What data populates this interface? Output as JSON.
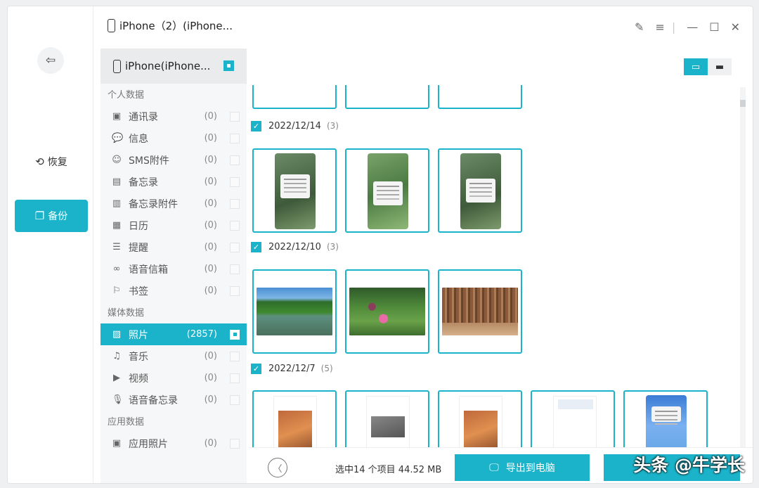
{
  "window": {
    "title": "iPhone（2）(iPhone..."
  },
  "rail": {
    "back_icon": "exit-icon",
    "nav": [
      {
        "icon": "refresh",
        "label": "恢复"
      },
      {
        "icon": "copy",
        "label": "备份"
      }
    ]
  },
  "sidebar": {
    "device": "iPhone(iPhone...",
    "groups": [
      {
        "title": "个人数据",
        "items": [
          {
            "icon": "contacts",
            "label": "通讯录",
            "count": "(0)"
          },
          {
            "icon": "message",
            "label": "信息",
            "count": "(0)"
          },
          {
            "icon": "sms-attachment",
            "label": "SMS附件",
            "count": "(0)"
          },
          {
            "icon": "notes",
            "label": "备忘录",
            "count": "(0)"
          },
          {
            "icon": "notes-attachment",
            "label": "备忘录附件",
            "count": "(0)"
          },
          {
            "icon": "calendar",
            "label": "日历",
            "count": "(0)"
          },
          {
            "icon": "reminder",
            "label": "提醒",
            "count": "(0)"
          },
          {
            "icon": "voicemail",
            "label": "语音信箱",
            "count": "(0)"
          },
          {
            "icon": "bookmark",
            "label": "书签",
            "count": "(0)"
          }
        ]
      },
      {
        "title": "媒体数据",
        "items": [
          {
            "icon": "photo",
            "label": "照片",
            "count": "(2857)",
            "selected": true
          },
          {
            "icon": "music",
            "label": "音乐",
            "count": "(0)"
          },
          {
            "icon": "video",
            "label": "视频",
            "count": "(0)"
          },
          {
            "icon": "mic",
            "label": "语音备忘录",
            "count": "(0)"
          }
        ]
      },
      {
        "title": "应用数据",
        "items": [
          {
            "icon": "app-photo",
            "label": "应用照片",
            "count": "(0)"
          }
        ]
      }
    ]
  },
  "gallery": {
    "sections": [
      {
        "date": "2022/12/14",
        "count": "(3)"
      },
      {
        "date": "2022/12/10",
        "count": "(3)"
      },
      {
        "date": "2022/12/7",
        "count": "(5)"
      }
    ]
  },
  "footer": {
    "selection": "选中14 个项目 44.52 MB",
    "export_label": "导出到电脑"
  },
  "watermark": "头条 @牛学长",
  "colors": {
    "accent": "#1bb3c9"
  }
}
